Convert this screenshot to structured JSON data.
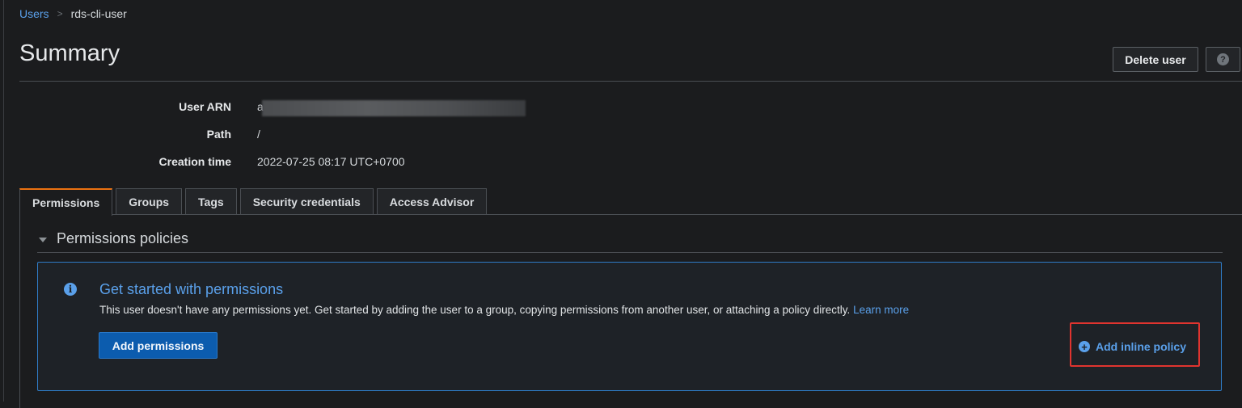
{
  "breadcrumb": {
    "root": "Users",
    "separator": ">",
    "current": "rds-cli-user"
  },
  "page": {
    "title": "Summary"
  },
  "actions": {
    "delete_label": "Delete user",
    "help_icon": "question-circle-icon",
    "help_glyph": "?"
  },
  "summary": {
    "user_arn_label": "User ARN",
    "user_arn_value_visible": "a",
    "path_label": "Path",
    "path_value": "/",
    "creation_label": "Creation time",
    "creation_value": "2022-07-25 08:17 UTC+0700"
  },
  "tabs": [
    {
      "label": "Permissions",
      "active": true
    },
    {
      "label": "Groups"
    },
    {
      "label": "Tags"
    },
    {
      "label": "Security credentials"
    },
    {
      "label": "Access Advisor"
    }
  ],
  "permissions": {
    "section_title": "Permissions policies",
    "info_title": "Get started with permissions",
    "info_text": "This user doesn't have any permissions yet. Get started by adding the user to a group, copying permissions from another user, or attaching a policy directly.",
    "learn_more": "Learn more",
    "add_permissions": "Add permissions",
    "add_inline_policy": "Add inline policy",
    "info_glyph": "i",
    "plus_glyph": "+"
  },
  "colors": {
    "accent": "#5aa0ea",
    "active_tab": "#ec7211",
    "primary_button": "#0c5cae",
    "highlight": "#e0342f"
  }
}
